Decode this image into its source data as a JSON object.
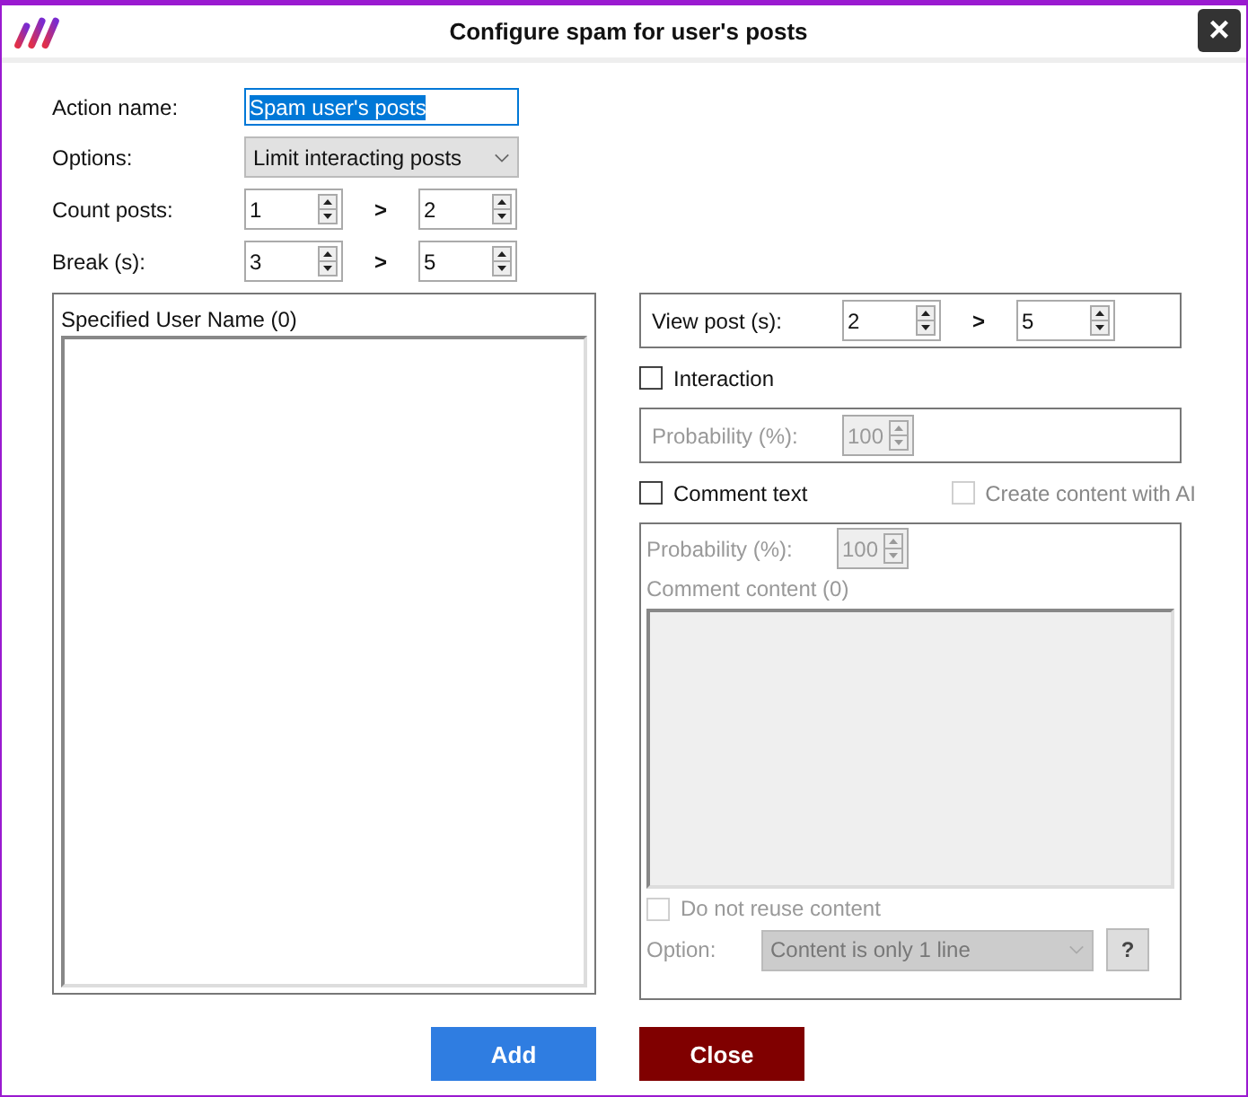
{
  "window": {
    "title": "Configure spam for user's posts",
    "close": "×"
  },
  "fields": [
    {
      "label": "Action name:",
      "kind": "text",
      "value": "Spam user's posts",
      "text_selected": true
    },
    {
      "label": "Options:",
      "kind": "dropdown",
      "value": "Limit interacting posts"
    },
    {
      "label": "Count posts:",
      "kind": "range",
      "from": "1",
      "separator": ">",
      "to": "2"
    },
    {
      "label": "Break (s):",
      "kind": "range",
      "from": "3",
      "separator": ">",
      "to": "5"
    }
  ],
  "user_list": {
    "title": "Specified User Name (0)"
  },
  "view_post": {
    "label": "View post (s):",
    "from": "2",
    "separator": ">",
    "to": "5"
  },
  "interaction": {
    "label": "Interaction",
    "checked": false,
    "probability": {
      "label": "Probability (%):",
      "value": "100"
    }
  },
  "comment": {
    "label": "Comment text",
    "checked": false,
    "ai": {
      "label": "Create content with AI",
      "checked": false
    },
    "probability": {
      "label": "Probability (%):",
      "value": "100"
    },
    "content_label": "Comment content (0)",
    "no_reuse": {
      "label": "Do not reuse content",
      "checked": false
    },
    "option": {
      "label": "Option:",
      "value": "Content is only 1 line"
    },
    "help": "?"
  },
  "buttons": [
    {
      "label": "Add",
      "kind": "primary"
    },
    {
      "label": "Close",
      "kind": "danger"
    }
  ]
}
